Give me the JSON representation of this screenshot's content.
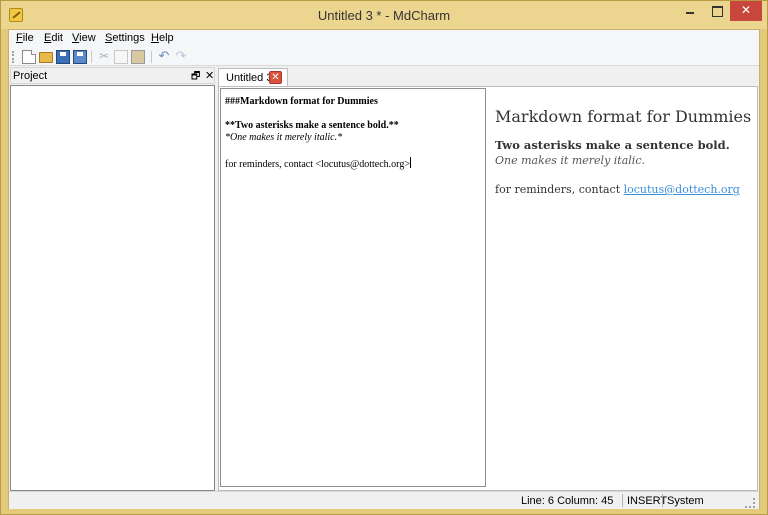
{
  "window": {
    "title": "Untitled 3 * - MdCharm",
    "close_glyph": "✕"
  },
  "menu": {
    "items": [
      {
        "key": "F",
        "rest": "ile"
      },
      {
        "key": "E",
        "rest": "dit"
      },
      {
        "key": "V",
        "rest": "iew"
      },
      {
        "key": "S",
        "rest": "ettings"
      },
      {
        "key": "H",
        "rest": "elp"
      }
    ]
  },
  "toolbar": {
    "icons": [
      "new-file-icon",
      "open-folder-icon",
      "save-icon",
      "save-all-icon",
      "cut-icon",
      "copy-icon",
      "paste-icon",
      "undo-icon",
      "redo-icon"
    ],
    "cut_glyph": "✂",
    "undo_glyph": "↶",
    "redo_glyph": "↷"
  },
  "project_panel": {
    "title": "Project",
    "float_glyph": "🗗",
    "close_glyph": "✕"
  },
  "tab": {
    "label": "Untitled 3",
    "close_glyph": "✕"
  },
  "editor": {
    "lines": [
      "###Markdown format for Dummies",
      "**Two asterisks make a sentence bold.**",
      "*One makes it merely italic.*",
      "for reminders, contact <locutus@dottech.org>"
    ]
  },
  "preview": {
    "heading": "Markdown format for Dummies",
    "bold": "Two asterisks make a sentence bold.",
    "italic": "One makes it merely italic.",
    "contact_prefix": "for reminders, contact ",
    "contact_link": "locutus@dottech.org"
  },
  "status": {
    "position": "Line: 6 Column: 45",
    "mode": "INSERT",
    "encoding": "System"
  },
  "colors": {
    "titlebar": "#ecd58f",
    "close_button": "#c9463d",
    "tab_close": "#d9523c",
    "link": "#3a8ed8"
  }
}
